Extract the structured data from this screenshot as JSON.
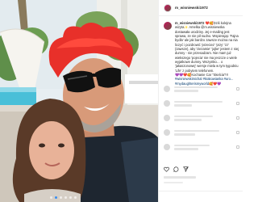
{
  "post": {
    "username": "m_wisniewski1972",
    "caption_username": "m_wisniewski1972",
    "caption_text": "❤️🥰Dziś kolejna wizyta✨ Amelka @m.wisniewska dostawała urodziny. Jej e-mailing jest sprawa, ze nie pił nudno. Wspierając 'Fajna bydla' ale jak bardzo zawsze można na nia liczyć i pozdrowić 'przeciez' 'przy' 'zz' (zawsze), aby 'ziezamie' 'jojke' jestem z niej dumny - nie przesadzam. Nie mam już wiekszego 'pojecia' nie ma jeszcze o wiele wyjatkowe dumny. Wszystko… o 'jakaszonowej' wersje miela w tym tygodniu 'Life' z pobytem telefonem.",
    "caption_emojis": "💜💜❤️🥰Kochanie Car \"Skelcia\"!!!",
    "caption_tags": "#wisniewskimichal #krakowianka #uro...",
    "caption_tags2": "#mydaughterismyworld🥰❤️💜",
    "carousel_dots": 6,
    "carousel_active": 1
  },
  "icons": {
    "header_avatar": "avatar-icon",
    "like": "heart-icon",
    "comment": "comment-icon",
    "share": "share-icon"
  },
  "colors": {
    "hair": "#e8302a",
    "tag_link": "#00376b",
    "active_dot": "#3a8ff2"
  }
}
